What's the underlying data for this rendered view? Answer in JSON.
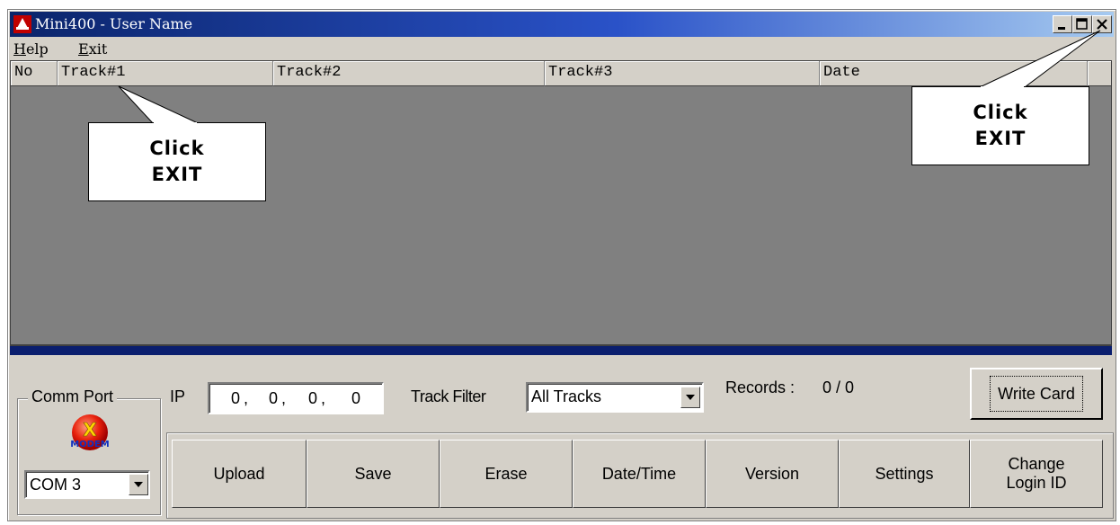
{
  "window": {
    "title": "Mini400  -  User Name"
  },
  "menu": {
    "items": [
      {
        "label": "Help",
        "accel": "H",
        "rest": "elp"
      },
      {
        "label": "Exit",
        "accel": "E",
        "rest": "xit"
      }
    ]
  },
  "list": {
    "columns": [
      "No",
      "Track#1",
      "Track#2",
      "Track#3",
      "Date"
    ],
    "rows": []
  },
  "comm_port": {
    "group_label": "Comm Port",
    "icon": "modem-icon",
    "icon_text": "MODEM",
    "selected": "COM 3"
  },
  "ip": {
    "label": "IP",
    "octets": [
      "0",
      "0",
      "0",
      "0"
    ]
  },
  "track_filter": {
    "label": "Track Filter",
    "selected": "All Tracks"
  },
  "records": {
    "label": "Records :",
    "value": "0 / 0"
  },
  "buttons": {
    "write_card": "Write Card",
    "toolbar": [
      "Upload",
      "Save",
      "Erase",
      "Date/Time",
      "Version",
      "Settings",
      "Change\nLogin ID"
    ]
  },
  "callouts": {
    "left": [
      "Click",
      "EXIT"
    ],
    "right": [
      "Click",
      "EXIT"
    ]
  },
  "colors": {
    "titlebar_start": "#0a246a",
    "titlebar_end": "#a6caf0",
    "face": "#d4d0c8",
    "list_bg": "#808080",
    "status_bar": "#0a1e6e"
  }
}
